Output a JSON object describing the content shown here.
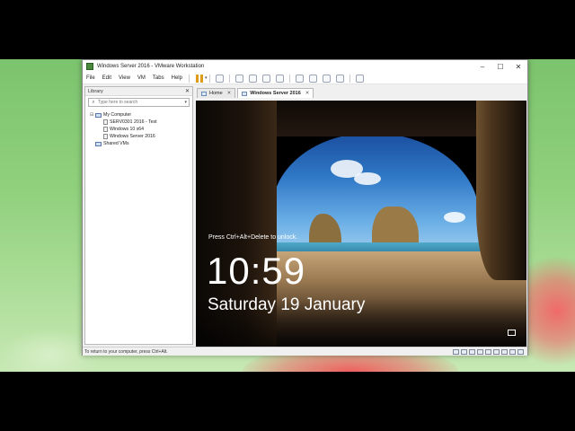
{
  "window": {
    "title": "Windows Server 2016 - VMware Workstation",
    "controls": {
      "minimize": "–",
      "maximize": "☐",
      "close": "✕"
    }
  },
  "menu": [
    "File",
    "Edit",
    "View",
    "VM",
    "Tabs",
    "Help"
  ],
  "library": {
    "title": "Library",
    "close": "✕",
    "search_placeholder": "Type here to search",
    "tree": {
      "root": "My Computer",
      "children": [
        "SERV0301 2016 - Test",
        "Windows 10 x64",
        "Windows Server 2016"
      ],
      "shared": "Shared VMs"
    }
  },
  "tabs": [
    {
      "label": "Home",
      "active": false
    },
    {
      "label": "Windows Server 2016",
      "active": true
    }
  ],
  "lockscreen": {
    "hint": "Press Ctrl+Alt+Delete to unlock.",
    "time": "10:59",
    "date": "Saturday 19 January"
  },
  "status": {
    "message": "To return to your computer, press Ctrl+Alt."
  }
}
